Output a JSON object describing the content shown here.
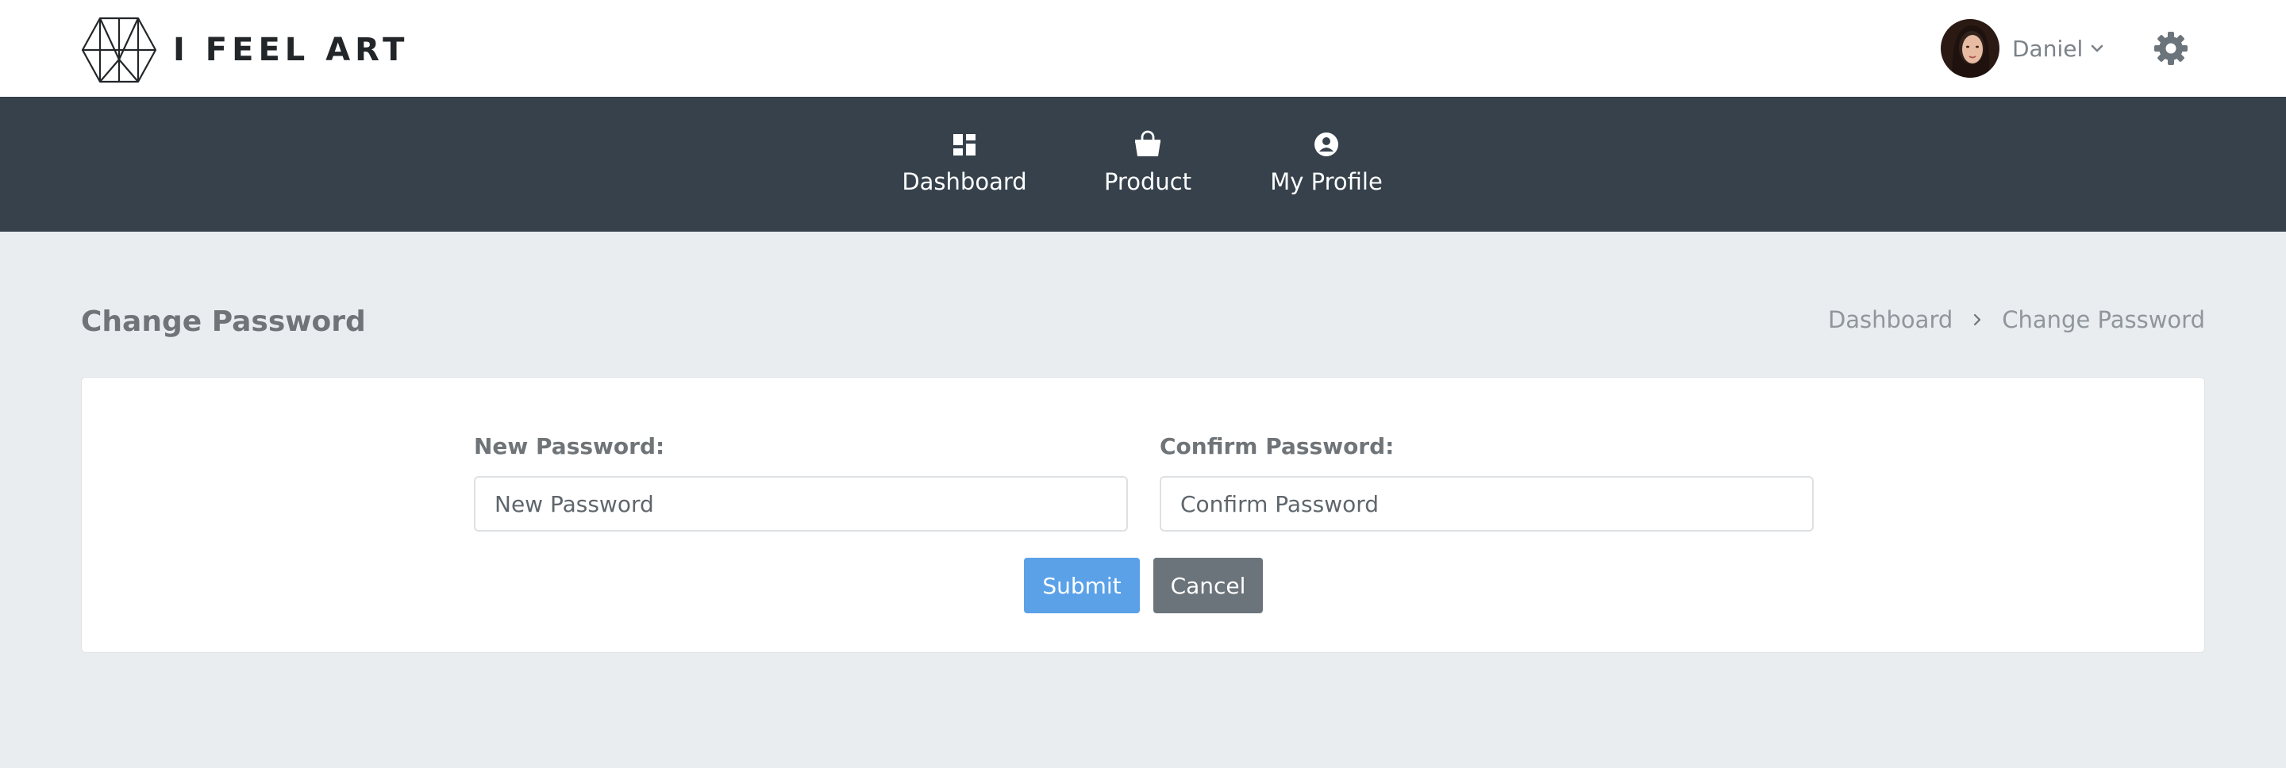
{
  "brand": {
    "name": "I FEEL ART"
  },
  "user": {
    "name": "Daniel"
  },
  "icons": {
    "logo": "geometric-hexagon-logo",
    "avatar": "user-avatar-photo",
    "user_menu": "chevron-down-icon",
    "settings": "gear-icon",
    "dashboard": "dashboard-grid-icon",
    "product": "shopping-bag-icon",
    "profile": "user-circle-icon",
    "breadcrumb_separator": "chevron-right-icon"
  },
  "nav": {
    "items": [
      {
        "label": "Dashboard",
        "icon": "dashboard-grid-icon"
      },
      {
        "label": "Product",
        "icon": "shopping-bag-icon"
      },
      {
        "label": "My Profile",
        "icon": "user-circle-icon"
      }
    ]
  },
  "page": {
    "title": "Change Password",
    "breadcrumb": [
      "Dashboard",
      "Change Password"
    ]
  },
  "form": {
    "new_password": {
      "label": "New Password:",
      "placeholder": "New Password",
      "value": ""
    },
    "confirm_password": {
      "label": "Confirm Password:",
      "placeholder": "Confirm Password",
      "value": ""
    },
    "submit_label": "Submit",
    "cancel_label": "Cancel"
  },
  "colors": {
    "navbar": "#36414b",
    "background": "#e9edf0",
    "primary": "#5aa1e8",
    "secondary": "#6c747b",
    "text_muted": "#6f7478"
  }
}
